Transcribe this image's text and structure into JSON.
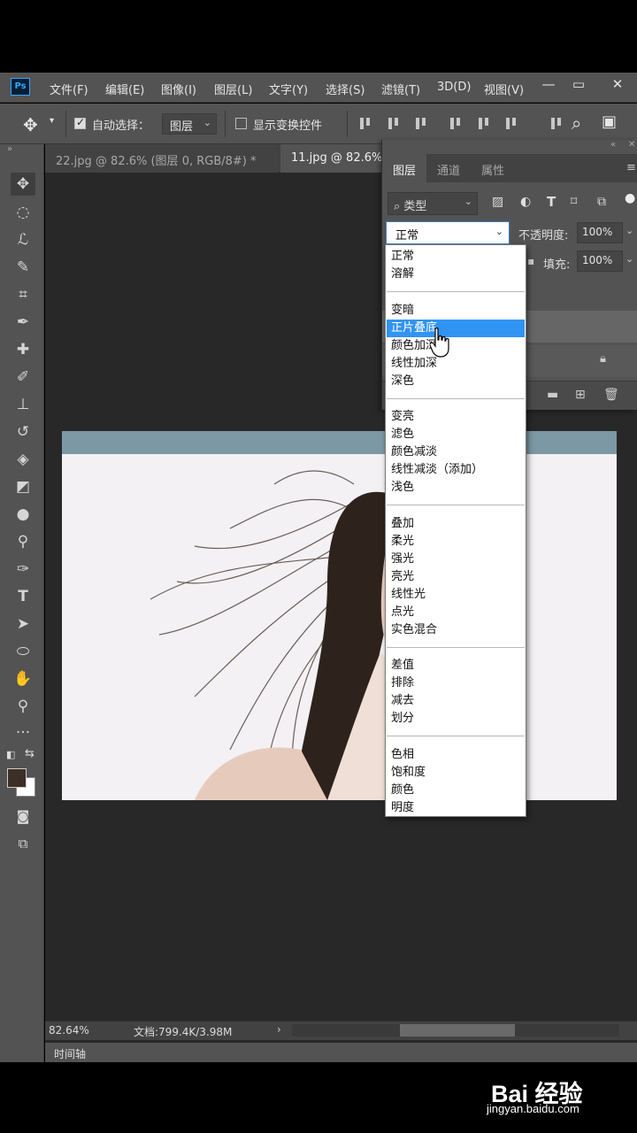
{
  "app": {
    "logo": "Ps"
  },
  "menu": {
    "items": [
      "文件(F)",
      "编辑(E)",
      "图像(I)",
      "图层(L)",
      "文字(Y)",
      "选择(S)",
      "滤镜(T)",
      "3D(D)",
      "视图(V)"
    ]
  },
  "options": {
    "auto_select_label": "自动选择：",
    "auto_select_value": "图层",
    "show_transform_label": "显示变换控件"
  },
  "tabs": [
    {
      "label": "22.jpg @ 82.6% (图层 0, RGB/8#) *"
    },
    {
      "label": "11.jpg @ 82.6%"
    }
  ],
  "layers_panel": {
    "tabs": [
      "图层",
      "通道",
      "属性"
    ],
    "filter_label": "类型",
    "blend_mode": "正常",
    "opacity_label": "不透明度:",
    "opacity_value": "100%",
    "fill_label": "填充:",
    "fill_value": "100%"
  },
  "blend_menu": {
    "groups": [
      [
        "正常",
        "溶解"
      ],
      [
        "变暗",
        "正片叠底",
        "颜色加深",
        "线性加深",
        "深色"
      ],
      [
        "变亮",
        "滤色",
        "颜色减淡",
        "线性减淡（添加）",
        "浅色"
      ],
      [
        "叠加",
        "柔光",
        "强光",
        "亮光",
        "线性光",
        "点光",
        "实色混合"
      ],
      [
        "差值",
        "排除",
        "减去",
        "划分"
      ],
      [
        "色相",
        "饱和度",
        "颜色",
        "明度"
      ]
    ],
    "selected": "正片叠底"
  },
  "status": {
    "zoom": "82.64%",
    "doc_info": "文档:799.4K/3.98M"
  },
  "timeline_label": "时间轴",
  "watermark": {
    "logo": "Bai 经验",
    "url": "jingyan.baidu.com"
  },
  "colors": {
    "ui_panel": "#535353",
    "ui_dark": "#424242",
    "canvas_bg": "#282828",
    "selection": "#3193f2",
    "foreground": "#3d2e26",
    "background": "#ffffff"
  }
}
